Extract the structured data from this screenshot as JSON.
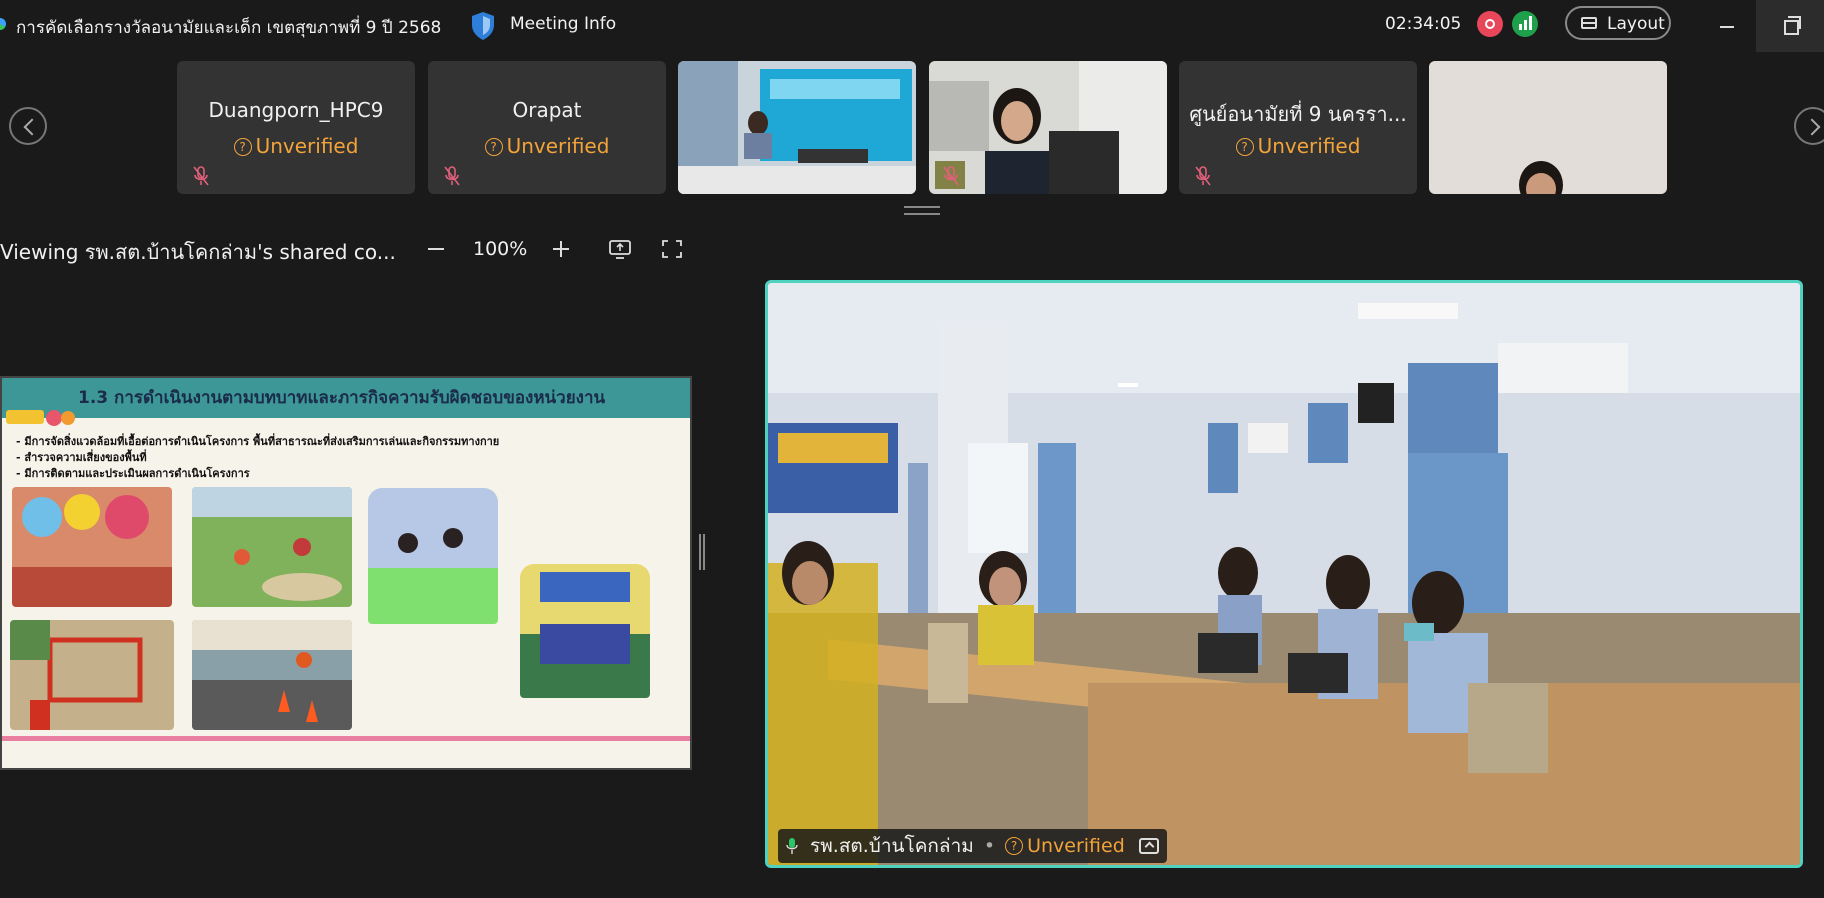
{
  "titlebar": {
    "meeting_title": "การคัดเลือกรางวัลอนามัยและเด็ก เขตสุขภาพที่ 9 ปี 2568",
    "meeting_info_label": "Meeting Info",
    "timer": "02:34:05",
    "layout_label": "Layout"
  },
  "participants": [
    {
      "name": "Duangporn_HPC9",
      "status": "Unverified"
    },
    {
      "name": "Orapat",
      "status": "Unverified"
    },
    {
      "name": "ศูนย์อนามัยที่ 9 นครรา...",
      "status": "Unverified"
    }
  ],
  "share_bar": {
    "viewing_text": "Viewing รพ.สต.บ้านโคกล่าม's shared co...",
    "zoom": "100%"
  },
  "slide": {
    "title": "1.3 การดำเนินงานตามบทบาทและภารกิจความรับผิดชอบของหน่วยงาน",
    "bullets": [
      "มีการจัดสิ่งแวดล้อมที่เอื้อต่อการดำเนินโครงการ พื้นที่สาธารณะที่ส่งเสริมการเล่นและกิจกรรมทางกาย",
      "สำรวจความเสี่ยงของพื้นที่",
      "มีการติดตามและประเมินผลการดำเนินโครงการ"
    ]
  },
  "active_speaker": {
    "name": "รพ.สต.บ้านโคกล่าม",
    "status": "Unverified"
  },
  "colors": {
    "accent_border": "#4fd1c0",
    "unverified": "#f2a33a",
    "record": "#e8475a",
    "stats": "#1fa04b",
    "slide_header": "#3c9796"
  },
  "icons": [
    "shield-icon",
    "record-icon",
    "stats-icon",
    "layout-icon",
    "mic-off-icon",
    "question-icon",
    "share-screen-icon",
    "fullscreen-icon",
    "mic-icon",
    "upload-icon"
  ]
}
